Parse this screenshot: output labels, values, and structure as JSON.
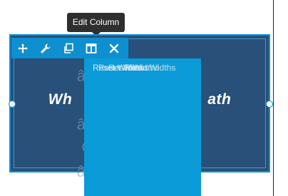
{
  "tooltip": {
    "text": "Edit Column"
  },
  "toolbar": {
    "icons": [
      "move-icon",
      "wrench-icon",
      "duplicate-icon",
      "columns-icon",
      "close-icon"
    ]
  },
  "headline": {
    "left": "Wh",
    "right": "ath"
  },
  "dropdown": {
    "item_text": "Reset Widths",
    "garbled_text": "â€",
    "garbled_text_2": "¢"
  },
  "colors": {
    "column_bg": "#285078",
    "accent": "#0e8fd0",
    "menu_bg": "#0a9bd8"
  }
}
